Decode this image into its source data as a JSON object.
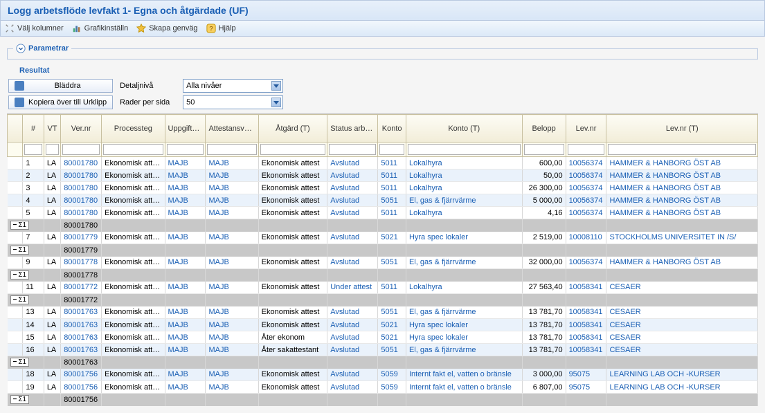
{
  "title": "Logg arbetsflöde levfakt 1- Egna och åtgärdade (UF)",
  "toolbar": {
    "cols": "Välj kolumner",
    "graph": "Grafikinställn",
    "shortcut": "Skapa genväg",
    "help": "Hjälp"
  },
  "params_label": "Parametrar",
  "result_label": "Resultat",
  "controls": {
    "browse": "Bläddra",
    "copy": "Kopiera över till Urklipp",
    "detail_label": "Detaljnivå",
    "detail_value": "Alla nivåer",
    "rows_label": "Rader per sida",
    "rows_value": "50"
  },
  "columns": [
    "",
    "#",
    "VT",
    "Ver.nr",
    "Processteg",
    "Uppgiften bearbetad av",
    "Attestansvarig",
    "Åtgärd (T)",
    "Status arbetsflöde (T)",
    "Konto",
    "Konto (T)",
    "Belopp",
    "Lev.nr",
    "Lev.nr (T)"
  ],
  "rows": [
    {
      "t": "d",
      "n": "1",
      "vt": "LA",
      "ver": "80001780",
      "proc": "Ekonomisk attest",
      "upp": "MAJB",
      "att": "MAJB",
      "atg": "Ekonomisk attest",
      "stat": "Avslutad",
      "konto": "5011",
      "kontot": "Lokalhyra",
      "bel": "600,00",
      "lev": "10056374",
      "levt": "HAMMER & HANBORG ÖST AB"
    },
    {
      "t": "d",
      "n": "2",
      "vt": "LA",
      "ver": "80001780",
      "proc": "Ekonomisk attest",
      "upp": "MAJB",
      "att": "MAJB",
      "atg": "Ekonomisk attest",
      "stat": "Avslutad",
      "konto": "5011",
      "kontot": "Lokalhyra",
      "bel": "50,00",
      "lev": "10056374",
      "levt": "HAMMER & HANBORG ÖST AB"
    },
    {
      "t": "d",
      "n": "3",
      "vt": "LA",
      "ver": "80001780",
      "proc": "Ekonomisk attest",
      "upp": "MAJB",
      "att": "MAJB",
      "atg": "Ekonomisk attest",
      "stat": "Avslutad",
      "konto": "5011",
      "kontot": "Lokalhyra",
      "bel": "26 300,00",
      "lev": "10056374",
      "levt": "HAMMER & HANBORG ÖST AB"
    },
    {
      "t": "d",
      "n": "4",
      "vt": "LA",
      "ver": "80001780",
      "proc": "Ekonomisk attest",
      "upp": "MAJB",
      "att": "MAJB",
      "atg": "Ekonomisk attest",
      "stat": "Avslutad",
      "konto": "5051",
      "kontot": "El, gas & fjärrvärme",
      "bel": "5 000,00",
      "lev": "10056374",
      "levt": "HAMMER & HANBORG ÖST AB"
    },
    {
      "t": "d",
      "n": "5",
      "vt": "LA",
      "ver": "80001780",
      "proc": "Ekonomisk attest",
      "upp": "MAJB",
      "att": "MAJB",
      "atg": "Ekonomisk attest",
      "stat": "Avslutad",
      "konto": "5011",
      "kontot": "Lokalhyra",
      "bel": "4,16",
      "lev": "10056374",
      "levt": "HAMMER & HANBORG ÖST AB"
    },
    {
      "t": "s",
      "ver": "80001780"
    },
    {
      "t": "d",
      "n": "7",
      "vt": "LA",
      "ver": "80001779",
      "proc": "Ekonomisk attest",
      "upp": "MAJB",
      "att": "MAJB",
      "atg": "Ekonomisk attest",
      "stat": "Avslutad",
      "konto": "5021",
      "kontot": "Hyra spec lokaler",
      "bel": "2 519,00",
      "lev": "10008110",
      "levt": "STOCKHOLMS UNIVERSITET IN /S/"
    },
    {
      "t": "s",
      "ver": "80001779"
    },
    {
      "t": "d",
      "n": "9",
      "vt": "LA",
      "ver": "80001778",
      "proc": "Ekonomisk attest",
      "upp": "MAJB",
      "att": "MAJB",
      "atg": "Ekonomisk attest",
      "stat": "Avslutad",
      "konto": "5051",
      "kontot": "El, gas & fjärrvärme",
      "bel": "32 000,00",
      "lev": "10056374",
      "levt": "HAMMER & HANBORG ÖST AB"
    },
    {
      "t": "s",
      "ver": "80001778"
    },
    {
      "t": "d",
      "n": "11",
      "vt": "LA",
      "ver": "80001772",
      "proc": "Ekonomisk attest",
      "upp": "MAJB",
      "att": "MAJB",
      "atg": "Ekonomisk attest",
      "stat": "Under attest",
      "konto": "5011",
      "kontot": "Lokalhyra",
      "bel": "27 563,40",
      "lev": "10058341",
      "levt": "CESAER"
    },
    {
      "t": "s",
      "ver": "80001772"
    },
    {
      "t": "d",
      "n": "13",
      "vt": "LA",
      "ver": "80001763",
      "proc": "Ekonomisk attest",
      "upp": "MAJB",
      "att": "MAJB",
      "atg": "Ekonomisk attest",
      "stat": "Avslutad",
      "konto": "5051",
      "kontot": "El, gas & fjärrvärme",
      "bel": "13 781,70",
      "lev": "10058341",
      "levt": "CESAER"
    },
    {
      "t": "d",
      "n": "14",
      "vt": "LA",
      "ver": "80001763",
      "proc": "Ekonomisk attest",
      "upp": "MAJB",
      "att": "MAJB",
      "atg": "Ekonomisk attest",
      "stat": "Avslutad",
      "konto": "5021",
      "kontot": "Hyra spec lokaler",
      "bel": "13 781,70",
      "lev": "10058341",
      "levt": "CESAER"
    },
    {
      "t": "d",
      "n": "15",
      "vt": "LA",
      "ver": "80001763",
      "proc": "Ekonomisk attest",
      "upp": "MAJB",
      "att": "MAJB",
      "atg": "Åter ekonom",
      "stat": "Avslutad",
      "konto": "5021",
      "kontot": "Hyra spec lokaler",
      "bel": "13 781,70",
      "lev": "10058341",
      "levt": "CESAER"
    },
    {
      "t": "d",
      "n": "16",
      "vt": "LA",
      "ver": "80001763",
      "proc": "Ekonomisk attest",
      "upp": "MAJB",
      "att": "MAJB",
      "atg": "Åter sakattestant",
      "stat": "Avslutad",
      "konto": "5051",
      "kontot": "El, gas & fjärrvärme",
      "bel": "13 781,70",
      "lev": "10058341",
      "levt": "CESAER"
    },
    {
      "t": "s",
      "ver": "80001763"
    },
    {
      "t": "d",
      "n": "18",
      "vt": "LA",
      "ver": "80001756",
      "proc": "Ekonomisk attest",
      "upp": "MAJB",
      "att": "MAJB",
      "atg": "Ekonomisk attest",
      "stat": "Avslutad",
      "konto": "5059",
      "kontot": "Internt fakt el, vatten o bränsle",
      "bel": "3 000,00",
      "lev": "95075",
      "levt": "LEARNING LAB OCH -KURSER"
    },
    {
      "t": "d",
      "n": "19",
      "vt": "LA",
      "ver": "80001756",
      "proc": "Ekonomisk attest",
      "upp": "MAJB",
      "att": "MAJB",
      "atg": "Ekonomisk attest",
      "stat": "Avslutad",
      "konto": "5059",
      "kontot": "Internt fakt el, vatten o bränsle",
      "bel": "6 807,00",
      "lev": "95075",
      "levt": "LEARNING LAB OCH -KURSER"
    },
    {
      "t": "s",
      "ver": "80001756"
    }
  ]
}
